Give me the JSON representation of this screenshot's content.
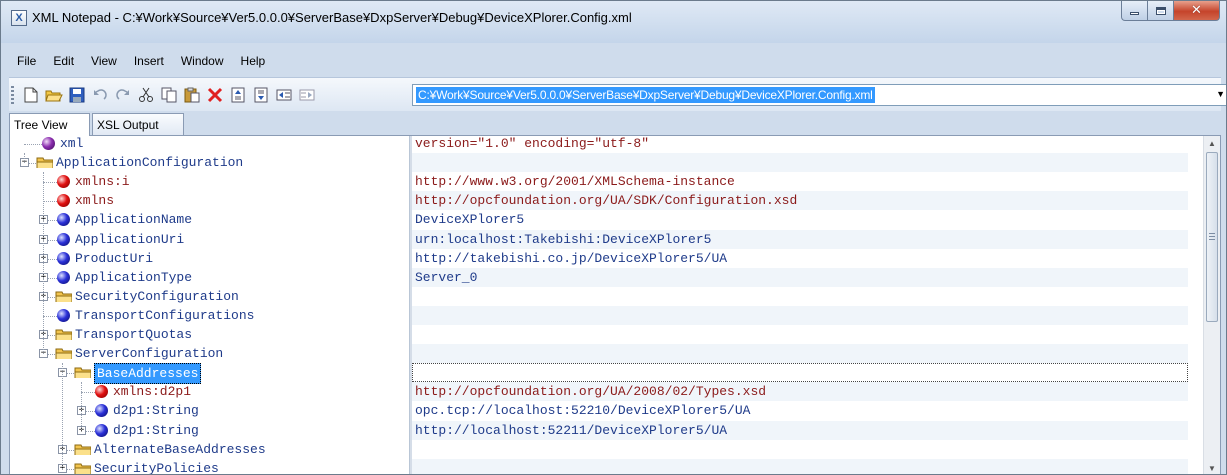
{
  "window": {
    "title": "XML Notepad - C:¥Work¥Source¥Ver5.0.0.0¥ServerBase¥DxpServer¥Debug¥DeviceXPlorer.Config.xml",
    "app_icon_glyph": "X"
  },
  "menu": [
    {
      "label": "File"
    },
    {
      "label": "Edit"
    },
    {
      "label": "View"
    },
    {
      "label": "Insert"
    },
    {
      "label": "Window"
    },
    {
      "label": "Help"
    }
  ],
  "toolbar": {
    "icons": [
      "new-icon",
      "open-icon",
      "save-icon",
      "undo-icon",
      "redo-icon",
      "cut-icon",
      "copy-icon",
      "paste-icon",
      "delete-icon",
      "nudge-up-icon",
      "nudge-down-icon",
      "nudge-left-icon",
      "nudge-right-icon"
    ],
    "location": "C:¥Work¥Source¥Ver5.0.0.0¥ServerBase¥DxpServer¥Debug¥DeviceXPlorer.Config.xml"
  },
  "tabs": [
    {
      "label": "Tree View",
      "active": true
    },
    {
      "label": "XSL Output",
      "active": false
    }
  ],
  "tree": [
    {
      "name": "xml",
      "kind": "pi",
      "depth": 0,
      "expander": "",
      "value": "version=\"1.0\" encoding=\"utf-8\""
    },
    {
      "name": "ApplicationConfiguration",
      "kind": "folder",
      "depth": 0,
      "expander": "−",
      "value": ""
    },
    {
      "name": "xmlns:i",
      "kind": "attribute",
      "depth": 1,
      "expander": "",
      "value": "http://www.w3.org/2001/XMLSchema-instance"
    },
    {
      "name": "xmlns",
      "kind": "attribute",
      "depth": 1,
      "expander": "",
      "value": "http://opcfoundation.org/UA/SDK/Configuration.xsd"
    },
    {
      "name": "ApplicationName",
      "kind": "element",
      "depth": 1,
      "expander": "+",
      "value": "DeviceXPlorer5"
    },
    {
      "name": "ApplicationUri",
      "kind": "element",
      "depth": 1,
      "expander": "+",
      "value": "urn:localhost:Takebishi:DeviceXPlorer5"
    },
    {
      "name": "ProductUri",
      "kind": "element",
      "depth": 1,
      "expander": "+",
      "value": "http://takebishi.co.jp/DeviceXPlorer5/UA"
    },
    {
      "name": "ApplicationType",
      "kind": "element",
      "depth": 1,
      "expander": "+",
      "value": "Server_0"
    },
    {
      "name": "SecurityConfiguration",
      "kind": "folder",
      "depth": 1,
      "expander": "+",
      "value": ""
    },
    {
      "name": "TransportConfigurations",
      "kind": "element",
      "depth": 1,
      "expander": "",
      "value": ""
    },
    {
      "name": "TransportQuotas",
      "kind": "folder",
      "depth": 1,
      "expander": "+",
      "value": ""
    },
    {
      "name": "ServerConfiguration",
      "kind": "folder",
      "depth": 1,
      "expander": "−",
      "value": ""
    },
    {
      "name": "BaseAddresses",
      "kind": "folder",
      "depth": 2,
      "expander": "−",
      "value": "",
      "selected": true
    },
    {
      "name": "xmlns:d2p1",
      "kind": "attribute",
      "depth": 3,
      "expander": "",
      "value": "http://opcfoundation.org/UA/2008/02/Types.xsd"
    },
    {
      "name": "d2p1:String",
      "kind": "element",
      "depth": 3,
      "expander": "+",
      "value": "opc.tcp://localhost:52210/DeviceXPlorer5/UA"
    },
    {
      "name": "d2p1:String",
      "kind": "element",
      "depth": 3,
      "expander": "+",
      "value": "http://localhost:52211/DeviceXPlorer5/UA"
    },
    {
      "name": "AlternateBaseAddresses",
      "kind": "folder",
      "depth": 2,
      "expander": "+",
      "value": ""
    },
    {
      "name": "SecurityPolicies",
      "kind": "folder",
      "depth": 2,
      "expander": "+",
      "value": ""
    }
  ],
  "colors": {
    "accent": "#3399ff",
    "element_text": "#1f3b8a",
    "attribute_text": "#8b1a1a"
  }
}
